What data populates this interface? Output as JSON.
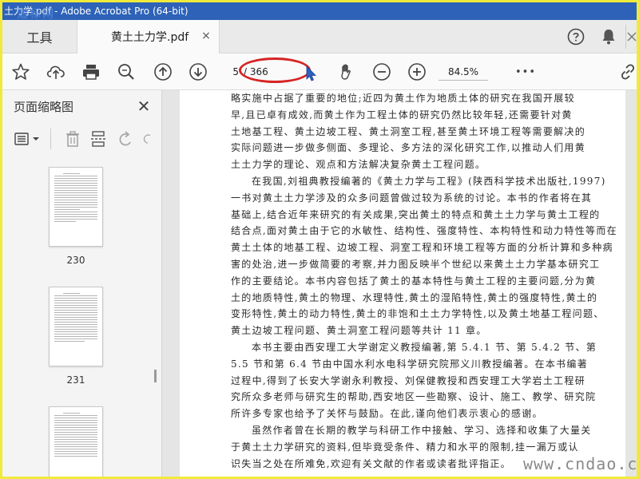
{
  "window": {
    "title": "土力学.pdf - Adobe Acrobat Pro (64-bit)",
    "watermark": "道标网",
    "bottom_watermark": "www.cndao.com"
  },
  "tabs": {
    "tools_label": "工具",
    "document_label": "黄土土力学.pdf",
    "close_glyph": "×"
  },
  "header_icons": [
    "help-icon",
    "notification-bell-icon",
    "divider-icon"
  ],
  "toolbar": {
    "current_page": "5",
    "total_pages": "/ 366",
    "zoom": "84.5%",
    "more_glyph": "•••"
  },
  "left_panel": {
    "title": "页面缩略图",
    "close_glyph": "✕",
    "thumbnails": [
      {
        "label": "230"
      },
      {
        "label": "231"
      },
      {
        "label": ""
      }
    ]
  },
  "document": {
    "paragraphs": [
      {
        "lines": [
          {
            "text": "略实施中占据了重要的地位;近四为黄土作为地质土体的研究在我国开展较",
            "indent": false
          },
          {
            "text": "早,且已卓有成效,而黄土作为工程土体的研究仍然比较年轻,还需要针对黄",
            "indent": false
          },
          {
            "text": "土地基工程、黄土边坡工程、黄土洞室工程,甚至黄土环境工程等需要解决的",
            "indent": false
          },
          {
            "text": "实际问题进一步做多侧面、多理论、多方法的深化研究工作,以推动人们用黄",
            "indent": false
          },
          {
            "text": "土土力学的理论、观点和方法解决复杂黄土工程问题。",
            "indent": false
          }
        ]
      },
      {
        "lines": [
          {
            "text": "在我国,刘祖典教授编著的《黄土力学与工程》(陕西科学技术出版社,1997)",
            "indent": true
          },
          {
            "text": "一书对黄土土力学涉及的众多问题曾做过较为系统的讨论。本书的作者将在其",
            "indent": false
          },
          {
            "text": "基础上,结合近年来研究的有关成果,突出黄土的特点和黄土土力学与黄土工程的",
            "indent": false
          },
          {
            "text": "结合点,面对黄土由于它的水敏性、结构性、强度特性、本构特性和动力特性等而在",
            "indent": false
          },
          {
            "text": "黄土土体的地基工程、边坡工程、洞室工程和环境工程等方面的分析计算和多种病",
            "indent": false
          },
          {
            "text": "害的处治,进一步做简要的考察,并力图反映半个世纪以来黄土土力学基本研究工",
            "indent": false
          },
          {
            "text": "作的主要结论。本书内容包括了黄土的基本特性与黄土工程的主要问题,分为黄",
            "indent": false
          },
          {
            "text": "土的地质特性,黄土的物理、水理特性,黄土的湿陷特性,黄土的强度特性,黄土的",
            "indent": false
          },
          {
            "text": "变形特性,黄土的动力特性,黄土的非饱和土土力学特性,以及黄土地基工程问题、",
            "indent": false
          },
          {
            "text": "黄土边坡工程问题、黄土洞室工程问题等共计 11 章。",
            "indent": false
          }
        ]
      },
      {
        "lines": [
          {
            "text": "本书主要由西安理工大学谢定义教授编著,第 5.4.1 节、第 5.4.2 节、第",
            "indent": true
          },
          {
            "text": "5.5 节和第 6.4 节由中国水利水电科学研究院邢义川教授编著。在本书编著",
            "indent": false
          },
          {
            "text": "过程中,得到了长安大学谢永利教授、刘保健教授和西安理工大学岩土工程研",
            "indent": false
          },
          {
            "text": "究所众多老师与研究生的帮助,西安地区一些勘察、设计、施工、教学、研究院",
            "indent": false
          },
          {
            "text": "所许多专家也给予了关怀与鼓励。在此,谨向他们表示衷心的感谢。",
            "indent": false
          }
        ]
      },
      {
        "lines": [
          {
            "text": "虽然作者曾在长期的教学与科研工作中接触、学习、选择和收集了大量关",
            "indent": true
          },
          {
            "text": "于黄土土力学研究的资料,但毕竟受条件、精力和水平的限制,挂一漏万或认",
            "indent": false
          },
          {
            "text": "识失当之处在所难免,欢迎有关文献的作者或读者批评指正。",
            "indent": false
          }
        ]
      }
    ]
  }
}
